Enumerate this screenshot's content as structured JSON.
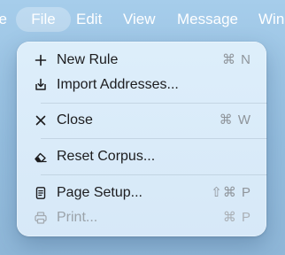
{
  "menubar": {
    "app_partial": "ve",
    "file": "File",
    "edit": "Edit",
    "view": "View",
    "message": "Message",
    "window_partial": "Wind"
  },
  "file_menu": {
    "items": [
      {
        "label": "New Rule",
        "shortcut": "⌘ N",
        "icon": "plus-icon",
        "enabled": true
      },
      {
        "label": "Import Addresses...",
        "shortcut": "",
        "icon": "import-tray-icon",
        "enabled": true
      },
      {
        "label": "Close",
        "shortcut": "⌘ W",
        "icon": "close-x-icon",
        "enabled": true
      },
      {
        "label": "Reset Corpus...",
        "shortcut": "",
        "icon": "eraser-icon",
        "enabled": true
      },
      {
        "label": "Page Setup...",
        "shortcut": "⇧⌘ P",
        "icon": "document-icon",
        "enabled": true
      },
      {
        "label": "Print...",
        "shortcut": "⌘ P",
        "icon": "printer-icon",
        "enabled": false
      }
    ]
  }
}
